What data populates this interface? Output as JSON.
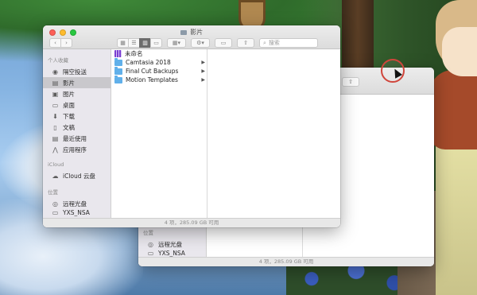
{
  "front_window": {
    "title": "影片",
    "toolbar": {
      "back_icon": "chevron-left-icon",
      "forward_icon": "chevron-right-icon",
      "view_modes": [
        "icon-view",
        "list-view",
        "column-view",
        "gallery-view"
      ],
      "active_view": "column-view",
      "search_placeholder": "搜索"
    },
    "sidebar": {
      "sections": [
        {
          "heading": "个人收藏",
          "items": [
            {
              "label": "隔空投送",
              "icon": "airdrop-icon"
            },
            {
              "label": "影片",
              "icon": "film-icon",
              "selected": true
            },
            {
              "label": "图片",
              "icon": "photo-icon"
            },
            {
              "label": "桌面",
              "icon": "desktop-icon"
            },
            {
              "label": "下载",
              "icon": "download-icon"
            },
            {
              "label": "文稿",
              "icon": "document-icon"
            },
            {
              "label": "最近使用",
              "icon": "clock-icon"
            },
            {
              "label": "应用程序",
              "icon": "apps-icon"
            }
          ]
        },
        {
          "heading": "iCloud",
          "items": [
            {
              "label": "iCloud 云盘",
              "icon": "cloud-icon"
            }
          ]
        },
        {
          "heading": "位置",
          "items": [
            {
              "label": "远程光盘",
              "icon": "disc-icon"
            },
            {
              "label": "YXS_NSA",
              "icon": "drive-icon"
            }
          ]
        }
      ]
    },
    "files": [
      {
        "name": "未命名",
        "icon": "purple-grid-icon",
        "has_children": false
      },
      {
        "name": "Camtasia 2018",
        "icon": "folder-icon",
        "has_children": true
      },
      {
        "name": "Final Cut Backups",
        "icon": "folder-icon",
        "has_children": true
      },
      {
        "name": "Motion Templates",
        "icon": "folder-icon",
        "has_children": true
      }
    ],
    "status": "4 项，285.09 GB 可用"
  },
  "back_window": {
    "sidebar": {
      "heading": "位置",
      "items": [
        {
          "label": "远程光盘",
          "icon": "disc-icon"
        },
        {
          "label": "YXS_NSA",
          "icon": "drive-icon"
        }
      ]
    },
    "status": "4 项，285.09 GB 可用"
  },
  "colors": {
    "folder": "#60b0ea",
    "sidebar_bg": "#e9e7ed",
    "click_ring": "#d0463c"
  }
}
